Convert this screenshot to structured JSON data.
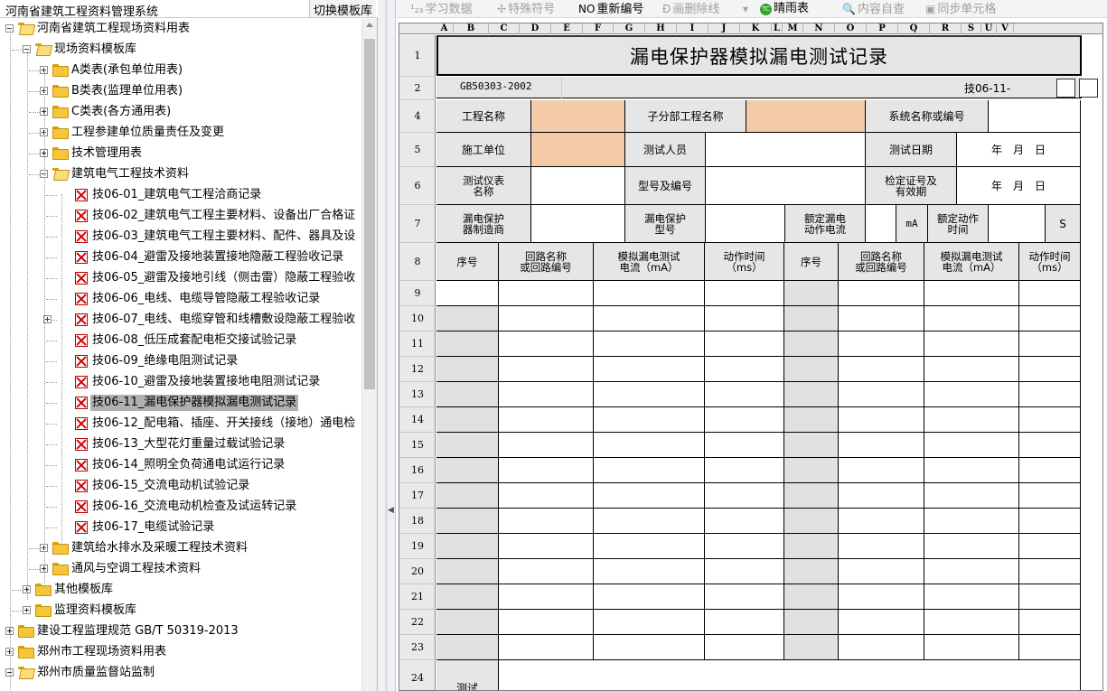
{
  "left_panel": {
    "title": "河南省建筑工程资料管理系统",
    "switch_button": "切换模板库",
    "tree": [
      {
        "label": "河南省建筑工程现场资料用表",
        "level": 0,
        "type": "folder",
        "expanded": true
      },
      {
        "label": "现场资料模板库",
        "level": 1,
        "type": "folder",
        "expanded": true
      },
      {
        "label": "A类表(承包单位用表)",
        "level": 2,
        "type": "folder",
        "expanded": false
      },
      {
        "label": "B类表(监理单位用表)",
        "level": 2,
        "type": "folder",
        "expanded": false
      },
      {
        "label": "C类表(各方通用表)",
        "level": 2,
        "type": "folder",
        "expanded": false
      },
      {
        "label": "工程参建单位质量责任及变更",
        "level": 2,
        "type": "folder",
        "expanded": false
      },
      {
        "label": "技术管理用表",
        "level": 2,
        "type": "folder",
        "expanded": false
      },
      {
        "label": "建筑电气工程技术资料",
        "level": 2,
        "type": "folder",
        "expanded": true
      },
      {
        "label": "技06-01_建筑电气工程洽商记录",
        "level": 3,
        "type": "doc"
      },
      {
        "label": "技06-02_建筑电气工程主要材料、设备出厂合格证",
        "level": 3,
        "type": "doc"
      },
      {
        "label": "技06-03_建筑电气工程主要材料、配件、器具及设",
        "level": 3,
        "type": "doc"
      },
      {
        "label": "技06-04_避雷及接地装置接地隐蔽工程验收记录",
        "level": 3,
        "type": "doc"
      },
      {
        "label": "技06-05_避雷及接地引线（侧击雷）隐蔽工程验收",
        "level": 3,
        "type": "doc"
      },
      {
        "label": "技06-06_电线、电缆导管隐蔽工程验收记录",
        "level": 3,
        "type": "doc"
      },
      {
        "label": "技06-07_电线、电缆穿管和线槽敷设隐蔽工程验收",
        "level": 3,
        "type": "doc",
        "has_children": true
      },
      {
        "label": "技06-08_低压成套配电柜交接试验记录",
        "level": 3,
        "type": "doc"
      },
      {
        "label": "技06-09_绝缘电阻测试记录",
        "level": 3,
        "type": "doc"
      },
      {
        "label": "技06-10_避雷及接地装置接地电阻测试记录",
        "level": 3,
        "type": "doc"
      },
      {
        "label": "技06-11_漏电保护器模拟漏电测试记录",
        "level": 3,
        "type": "doc",
        "selected": true
      },
      {
        "label": "技06-12_配电箱、插座、开关接线（接地）通电检",
        "level": 3,
        "type": "doc"
      },
      {
        "label": "技06-13_大型花灯重量过载试验记录",
        "level": 3,
        "type": "doc"
      },
      {
        "label": "技06-14_照明全负荷通电试运行记录",
        "level": 3,
        "type": "doc"
      },
      {
        "label": "技06-15_交流电动机试验记录",
        "level": 3,
        "type": "doc"
      },
      {
        "label": "技06-16_交流电动机检查及试运转记录",
        "level": 3,
        "type": "doc"
      },
      {
        "label": "技06-17_电缆试验记录",
        "level": 3,
        "type": "doc"
      },
      {
        "label": "建筑给水排水及采暖工程技术资料",
        "level": 2,
        "type": "folder",
        "expanded": false
      },
      {
        "label": "通风与空调工程技术资料",
        "level": 2,
        "type": "folder",
        "expanded": false
      },
      {
        "label": "其他模板库",
        "level": 1,
        "type": "folder",
        "expanded": false
      },
      {
        "label": "监理资料模板库",
        "level": 1,
        "type": "folder",
        "expanded": false
      },
      {
        "label": "建设工程监理规范 GB/T 50319-2013",
        "level": 0,
        "type": "folder",
        "expanded": false
      },
      {
        "label": "郑州市工程现场资料用表",
        "level": 0,
        "type": "folder",
        "expanded": false
      },
      {
        "label": "郑州市质量监督站监制",
        "level": 0,
        "type": "folder",
        "expanded": true
      }
    ]
  },
  "toolbar": {
    "study": {
      "label": "学习数据",
      "icon": "¹₂₃",
      "enabled": false
    },
    "special": {
      "label": "特殊符号",
      "icon": "✢",
      "enabled": false
    },
    "renumber": {
      "label": "重新编号",
      "icon": "NO",
      "enabled": true
    },
    "strike": {
      "label": "画删除线",
      "icon": "Ð",
      "enabled": false
    },
    "dropdown": {
      "icon": "▾",
      "enabled": false
    },
    "weather": {
      "label": "晴雨表",
      "icon": "TC",
      "enabled": true
    },
    "check": {
      "label": "内容自查",
      "icon": "🔍",
      "enabled": false
    },
    "sync": {
      "label": "同步单元格",
      "icon": "▣",
      "enabled": false
    }
  },
  "sheet": {
    "columns": [
      "A",
      "B",
      "C",
      "D",
      "E",
      "F",
      "G",
      "H",
      "I",
      "J",
      "K",
      "L",
      "M",
      "N",
      "O",
      "P",
      "Q",
      "R",
      "S",
      "U",
      "V"
    ],
    "title": "漏电保护器模拟漏电测试记录",
    "standard": "GB50303-2002",
    "tech_code": "技06-11-",
    "row_numbers": [
      "1",
      "2",
      "4",
      "5",
      "6",
      "7",
      "8",
      "9",
      "10",
      "11",
      "12",
      "13",
      "14",
      "15",
      "16",
      "17",
      "18",
      "19",
      "20",
      "21",
      "22",
      "23",
      "24"
    ],
    "labels": {
      "project_name": "工程名称",
      "sub_project": "子分部工程名称",
      "system_name": "系统名称或编号",
      "construction_unit": "施工单位",
      "tester": "测试人员",
      "test_date": "测试日期",
      "date_placeholder": "年　月　日",
      "instrument_1": "测试仪表",
      "instrument_2": "名称",
      "model_serial": "型号及编号",
      "cert_1": "检定证号及",
      "cert_2": "有效期",
      "manufacturer_1": "漏电保护",
      "manufacturer_2": "器制造商",
      "model_1": "漏电保护",
      "model_2": "型号",
      "rated_1": "额定漏电",
      "rated_2": "动作电流",
      "unit_ma": "mA",
      "action_time_1": "额定动作",
      "action_time_2": "时间",
      "unit_s": "S",
      "seq": "序号",
      "circuit_1": "回路名称",
      "circuit_2": "或回路编号",
      "leak_1": "模拟漏电测试",
      "leak_2": "电流（mA）",
      "time_1": "动作时间",
      "time_2": "（ms）",
      "conclusion": "测试"
    }
  }
}
